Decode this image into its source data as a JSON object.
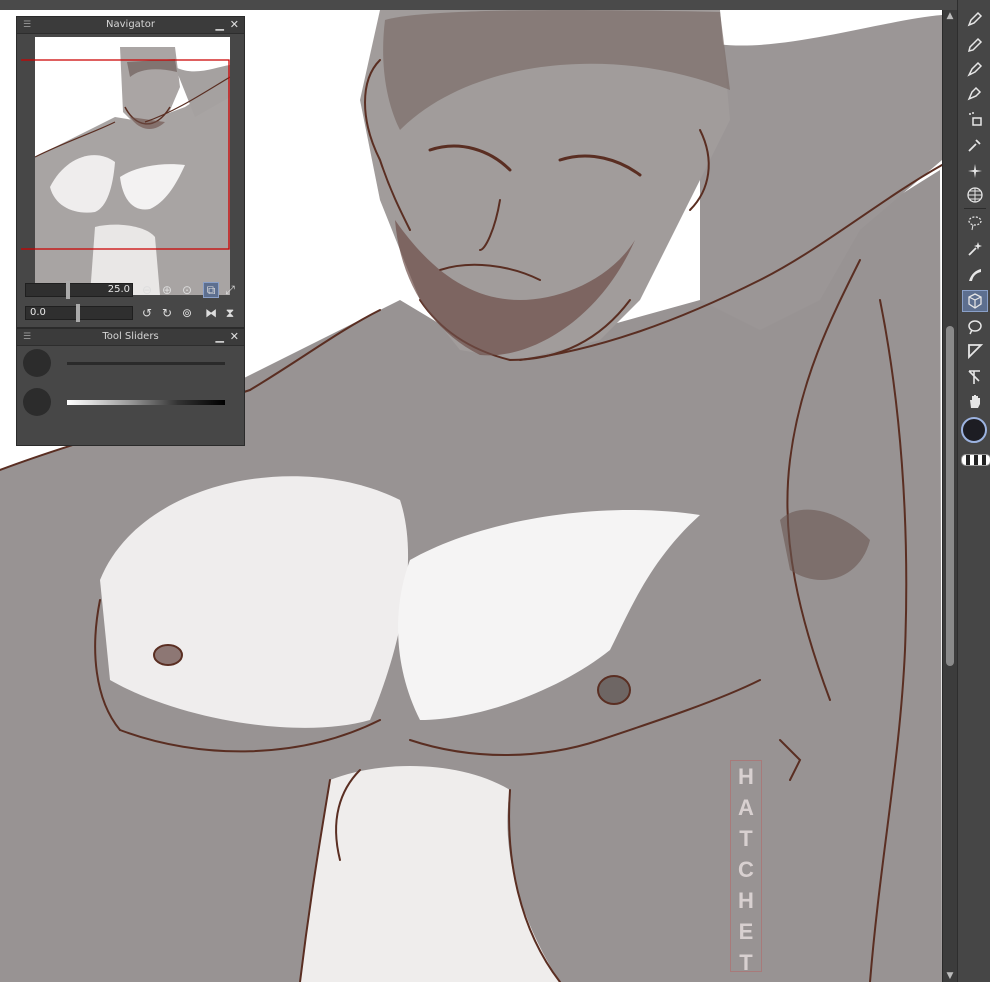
{
  "navigator": {
    "title": "Navigator",
    "zoom_value": "25.0",
    "rotation_value": "0.0"
  },
  "tool_sliders": {
    "title": "Tool Sliders"
  },
  "watermark": {
    "letters": [
      "H",
      "A",
      "T",
      "C",
      "H",
      "E",
      "T"
    ]
  },
  "colors": {
    "panel_bg": "#474747",
    "titlebar_bg": "#3b3b3b",
    "toolbar_bg": "#464646",
    "active_tool": "#5d6f8f",
    "line_art": "#5a2e22",
    "navigator_frame": "#cc0000",
    "main_color": "#1d1d23"
  },
  "toolbar": {
    "tools": [
      "pen-icon",
      "pencil-icon",
      "brush-icon",
      "ink-pen-icon",
      "airbrush-icon",
      "eyedropper-icon",
      "sparkle-icon",
      "grid-icon",
      "lasso-select-icon",
      "magic-wand-icon",
      "blend-icon",
      "cube-move-icon",
      "lasso-icon",
      "ruler-icon",
      "arrow-select-icon",
      "hand-icon"
    ]
  }
}
